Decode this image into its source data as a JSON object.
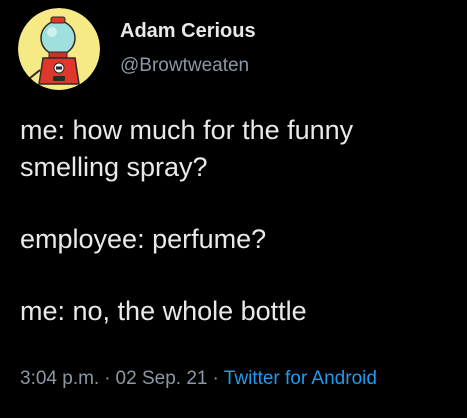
{
  "author": {
    "display_name": "Adam Cerious",
    "handle": "@Browtweaten",
    "avatar_icon": "gumball-machine-avatar-icon"
  },
  "tweet": {
    "paragraphs": [
      "me: how much for the funny\nsmelling spray?",
      "employee: perfume?",
      "me: no, the whole bottle"
    ]
  },
  "meta": {
    "time": "3:04 p.m.",
    "separator": "·",
    "date": "02 Sep. 21",
    "source": "Twitter for Android"
  },
  "colors": {
    "background": "#000000",
    "text": "#e7e9ea",
    "secondary_text": "#8b98a5",
    "link": "#1d9bf0",
    "avatar_background": "#f6ea86"
  }
}
